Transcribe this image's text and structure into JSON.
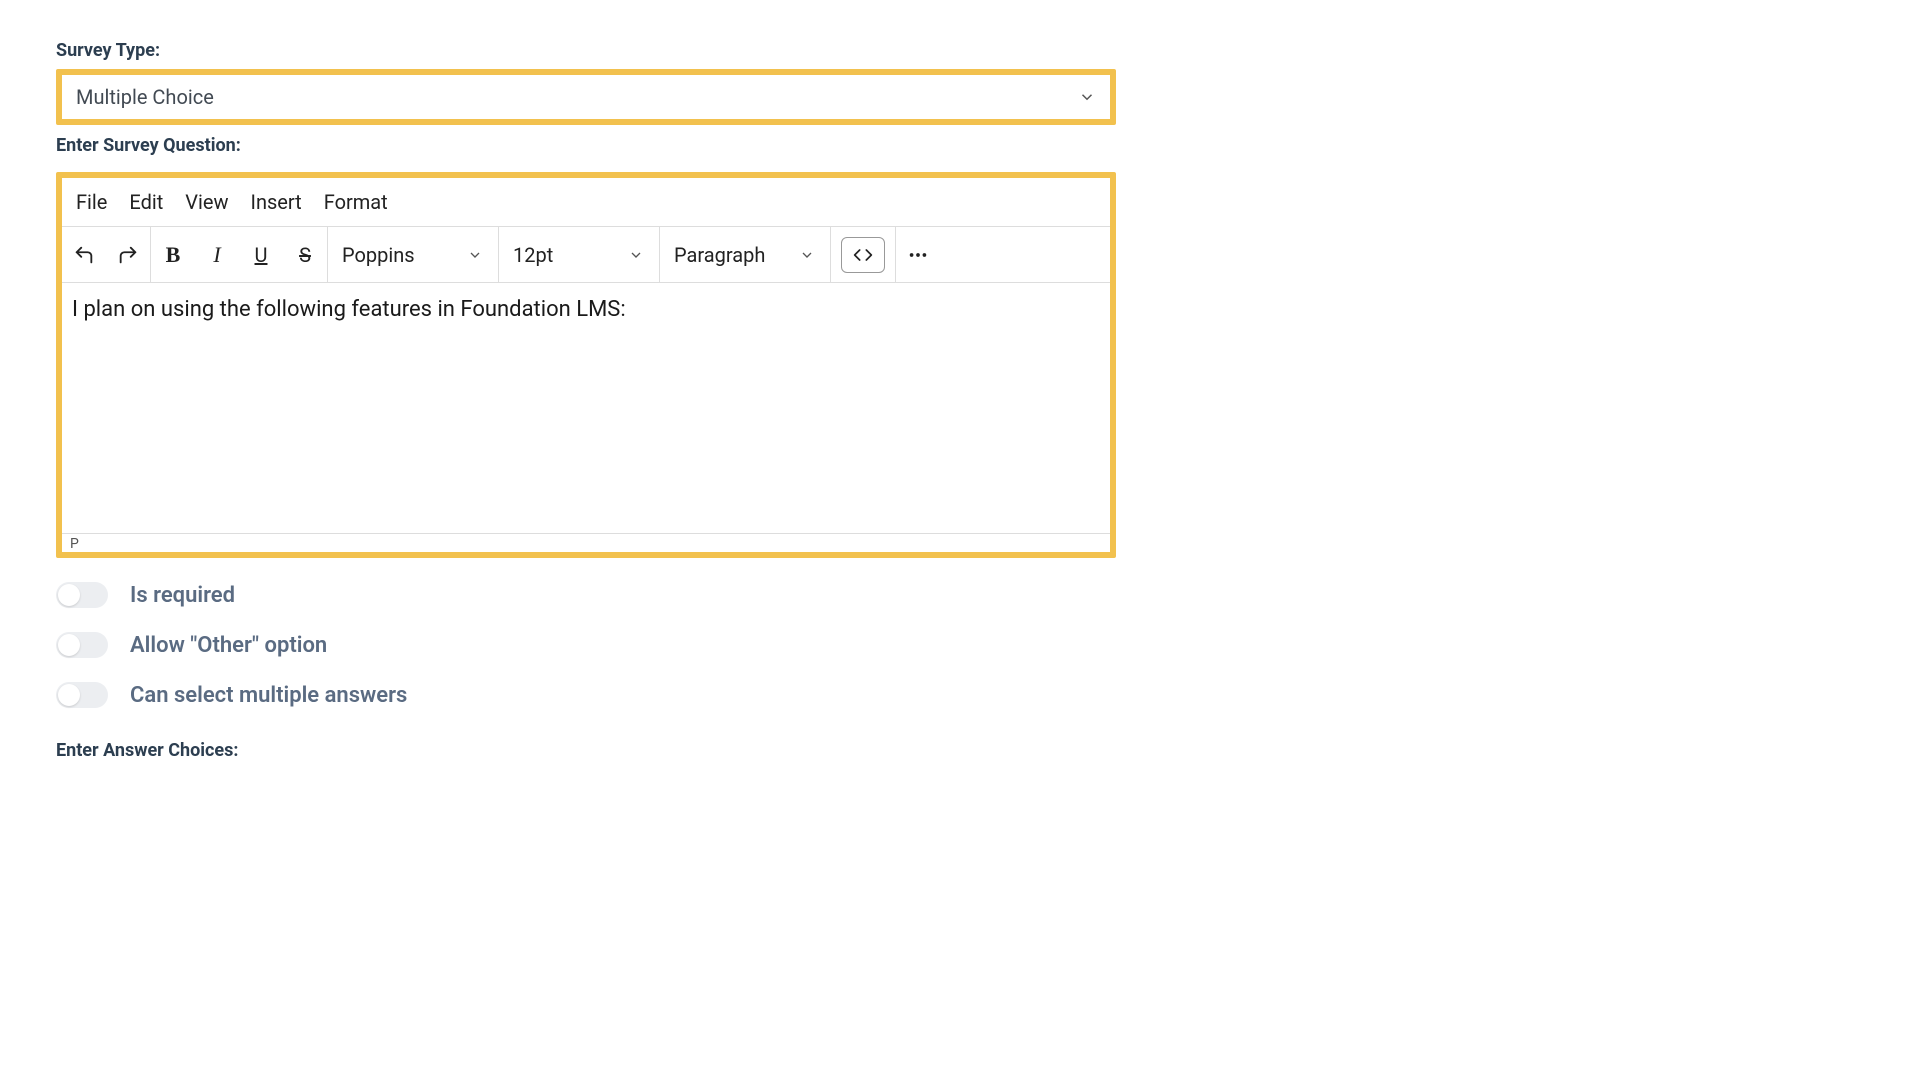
{
  "labels": {
    "survey_type": "Survey Type:",
    "enter_question": "Enter Survey Question:",
    "enter_answers": "Enter Answer Choices:"
  },
  "survey_type": {
    "selected": "Multiple Choice"
  },
  "editor": {
    "menu": {
      "file": "File",
      "edit": "Edit",
      "view": "View",
      "insert": "Insert",
      "format": "Format"
    },
    "toolbar": {
      "font": "Poppins",
      "size": "12pt",
      "block": "Paragraph",
      "bold": "B",
      "italic": "I",
      "underline": "U",
      "strike": "S"
    },
    "content": "I plan on using the following features in Foundation LMS:",
    "path": "P"
  },
  "toggles": {
    "required": "Is required",
    "other": "Allow \"Other\" option",
    "multi": "Can select multiple answers"
  }
}
